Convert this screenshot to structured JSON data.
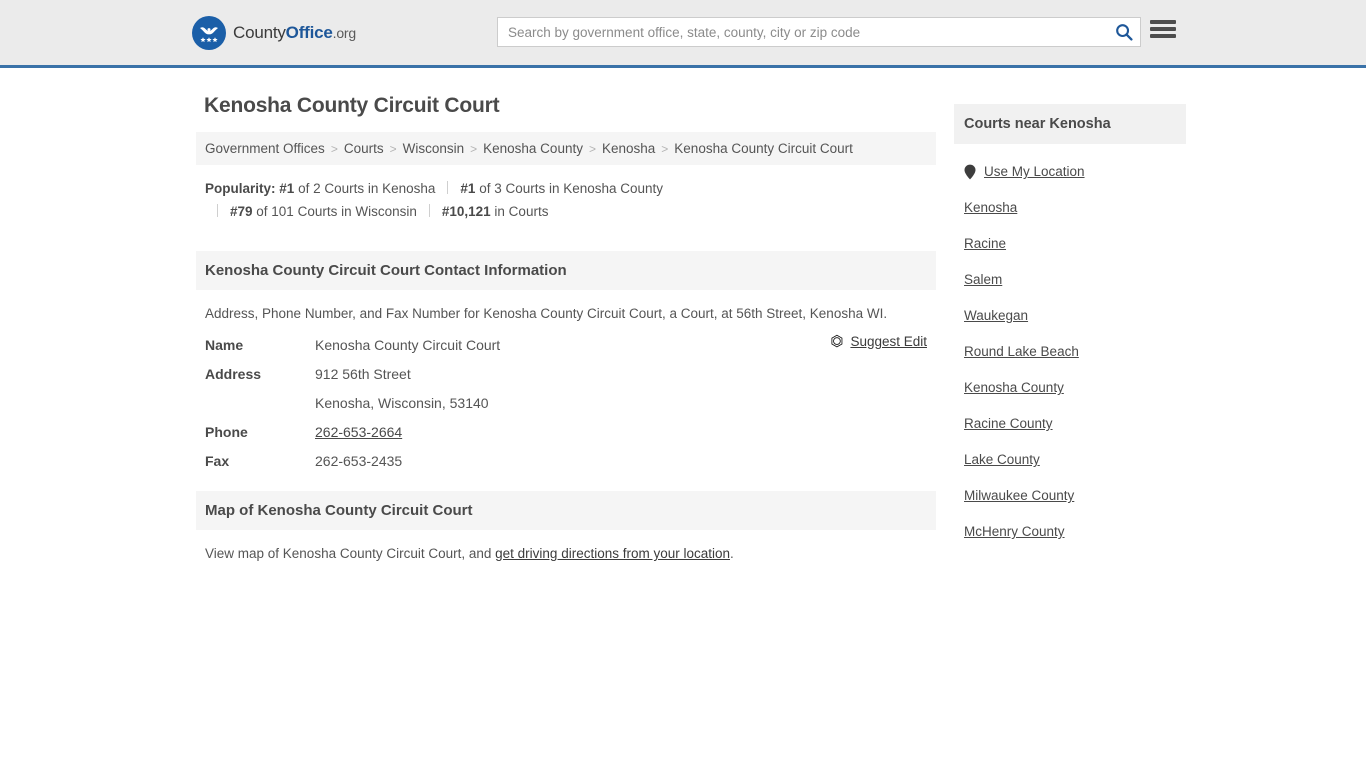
{
  "header": {
    "logo": {
      "part1": "County",
      "part2": "Office",
      "part3": ".org",
      "icon": "eagle-seal-icon"
    },
    "search": {
      "placeholder": "Search by government office, state, county, city or zip code",
      "value": "",
      "search_icon": "search-icon"
    },
    "menu_icon": "hamburger-menu-icon",
    "accent_color": "#1e5799",
    "border_color": "#3a72a8"
  },
  "page_title": "Kenosha County Circuit Court",
  "breadcrumb": [
    "Government Offices",
    "Courts",
    "Wisconsin",
    "Kenosha County",
    "Kenosha",
    "Kenosha County Circuit Court"
  ],
  "breadcrumb_separator": ">",
  "popularity": {
    "label": "Popularity:",
    "items": [
      {
        "rank": "#1",
        "text": "of 2 Courts in Kenosha"
      },
      {
        "rank": "#1",
        "text": "of 3 Courts in Kenosha County"
      },
      {
        "rank": "#79",
        "text": "of 101 Courts in Wisconsin"
      },
      {
        "rank": "#10,121",
        "text": "in Courts"
      }
    ]
  },
  "contact": {
    "heading": "Kenosha County Circuit Court Contact Information",
    "description": "Address, Phone Number, and Fax Number for Kenosha County Circuit Court, a Court, at 56th Street, Kenosha WI.",
    "suggest_edit": {
      "label": "Suggest Edit",
      "icon": "edit-pencil-icon"
    },
    "rows": [
      {
        "key": "Name",
        "value": "Kenosha County Circuit Court",
        "link": false
      },
      {
        "key": "Address",
        "value": "912 56th Street",
        "link": false
      },
      {
        "key": "",
        "value": "Kenosha, Wisconsin, 53140",
        "link": false
      },
      {
        "key": "Phone",
        "value": "262-653-2664",
        "link": true
      },
      {
        "key": "Fax",
        "value": "262-653-2435",
        "link": false
      }
    ]
  },
  "map": {
    "heading": "Map of Kenosha County Circuit Court",
    "desc_before": "View map of Kenosha County Circuit Court, and ",
    "link": "get driving directions from your location",
    "desc_after": "."
  },
  "sidebar": {
    "heading": "Courts near Kenosha",
    "use_my_location": {
      "label": "Use My Location",
      "icon": "map-pin-icon"
    },
    "links": [
      "Kenosha",
      "Racine",
      "Salem",
      "Waukegan",
      "Round Lake Beach",
      "Kenosha County",
      "Racine County",
      "Lake County",
      "Milwaukee County",
      "McHenry County"
    ]
  }
}
